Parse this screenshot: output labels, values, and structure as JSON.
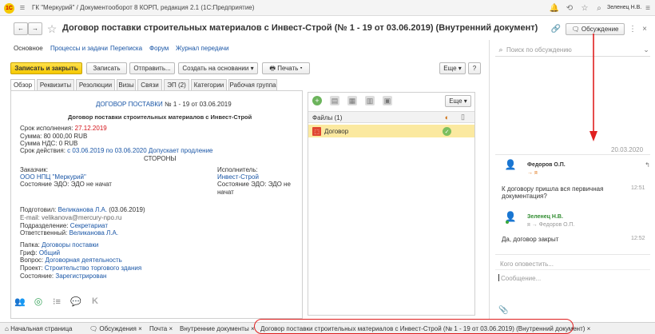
{
  "titlebar": {
    "title": "ГК \"Меркурий\" / Документооборот 8 КОРП, редакция 2.1  (1С:Предприятие)",
    "user": "Зеленец Н.В."
  },
  "header": {
    "doc_title": "Договор поставки строительных материалов с Инвест-Строй (№ 1 - 19 от 03.06.2019) (Внутренний документ)",
    "discussion_button": "Обсуждение"
  },
  "nav_links": {
    "main": "Основное",
    "processes": "Процессы и задачи",
    "correspondence": "Переписка",
    "forum": "Форум",
    "log": "Журнал передачи"
  },
  "toolbar": {
    "save_close": "Записать и закрыть",
    "save": "Записать",
    "send": "Отправить...",
    "create_based": "Создать на основании",
    "print": "Печать",
    "more": "Еще",
    "help": "?"
  },
  "tabs": [
    "Обзор",
    "Реквизиты",
    "Резолюции",
    "Визы",
    "Связи",
    "ЭП (2)",
    "Категории",
    "Рабочая группа"
  ],
  "overview": {
    "doc_type": "ДОГОВОР ПОСТАВКИ",
    "doc_num": " № 1 - 19 от 03.06.2019",
    "subject": "Договор поставки строительных материалов с Инвест-Строй",
    "deadline_label": "Срок исполнения: ",
    "deadline_value": "27.12.2019",
    "sum_label": "Сумма: ",
    "sum_value": "80 000,00 RUB",
    "vat_label": "Сумма НДС: ",
    "vat_value": "0 RUB",
    "term_label": "Срок действия: ",
    "term_value": "с 03.06.2019 по 03.06.2020",
    "term_extra": " Допускает продление",
    "parties_heading": "СТОРОНЫ",
    "customer_label": "Заказчик:",
    "customer_value": "ООО НПЦ \"Меркурий\"",
    "customer_edo": "Состояние ЭДО: ЭДО не начат",
    "executor_label": "Исполнитель:",
    "executor_value": "Инвест-Строй",
    "executor_edo_1": "Состояние ЭДО: ЭДО не",
    "executor_edo_2": "начат",
    "prepared_label": "Подготовил: ",
    "prepared_value": "Великанова Л.А.",
    "prepared_date": " (03.06.2019)",
    "email": "E-mail: velikanova@mercury-npo.ru",
    "dept_label": "Подразделение: ",
    "dept_value": "Секретариат",
    "resp_label": "Ответственный: ",
    "resp_value": "Великанова Л.А.",
    "folder_label": "Папка: ",
    "folder_value": "Договоры поставки",
    "stamp_label": "Гриф: ",
    "stamp_value": "Общий",
    "question_label": "Вопрос: ",
    "question_value": "Договорная деятельность",
    "project_label": "Проект: ",
    "project_value": "Строительство торгового здания",
    "state_label": "Состояние: ",
    "state_value": "Зарегистрирован"
  },
  "files": {
    "more": "Еще",
    "header": "Файлы (1)",
    "file_name": "Договор"
  },
  "discussion": {
    "search_placeholder": "Поиск по обсуждению",
    "date": "20.03.2020",
    "msg1_author": "Федоров О.П.",
    "msg1_to": "→ я",
    "msg1_text_1": "К договору пришла вся первичная",
    "msg1_text_2": "документация?",
    "msg1_time": "12:51",
    "msg2_author": "Зеленец Н.В.",
    "msg2_to": "я → Федоров О.П.",
    "msg2_text": "Да, договор закрыт",
    "msg2_time": "12:52",
    "to_placeholder": "Кого оповестить...",
    "msg_placeholder": "Сообщение..."
  },
  "bottom_tabs": {
    "home": "Начальная страница",
    "discussions": "Обсуждения",
    "mail": "Почта",
    "internal": "Внутренние документы",
    "current": "Договор поставки строительных материалов с Инвест-Строй (№ 1 - 19 от 03.06.2019) (Внутренний документ)"
  },
  "colors": {
    "accent_yellow": "#f5c800",
    "link": "#1a56a6",
    "annotation_red": "#e02020"
  }
}
